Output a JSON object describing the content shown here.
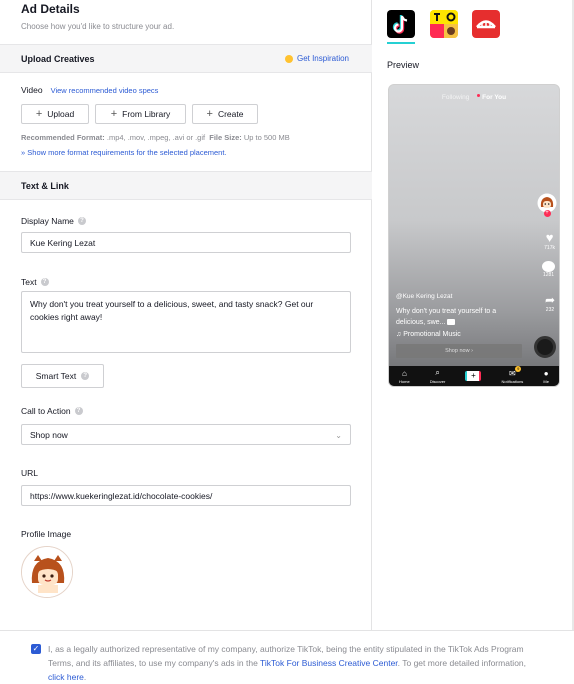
{
  "header": {
    "title": "Ad Details",
    "subtitle": "Choose how you'd like to structure your ad."
  },
  "upload": {
    "section_title": "Upload Creatives",
    "inspiration": "Get Inspiration",
    "video_label": "Video",
    "video_specs_link": "View recommended video specs",
    "buttons": {
      "upload": "Upload",
      "library": "From Library",
      "create": "Create"
    },
    "format_label": "Recommended Format:",
    "format_value": ".mp4, .mov, .mpeg, .avi or .gif",
    "size_label": "File Size:",
    "size_value": "Up to 500 MB",
    "more_link": "Show more format requirements for the selected placement."
  },
  "text_link": {
    "section_title": "Text & Link",
    "display_name_label": "Display Name",
    "display_name_value": "Kue Kering Lezat",
    "text_label": "Text",
    "text_value": "Why don't you treat yourself to a delicious, sweet, and tasty snack? Get our cookies right away!",
    "smart_text": "Smart Text",
    "cta_label": "Call to Action",
    "cta_value": "Shop now",
    "url_label": "URL",
    "url_value": "https://www.kuekeringlezat.id/chocolate-cookies/",
    "profile_label": "Profile Image"
  },
  "footer": {
    "consent_1": "I, as a legally authorized representative of my company, authorize TikTok, being the entity stipulated in the TikTok Ads Program Terms, and its affiliates, to use my company's ads in the ",
    "consent_link": "TikTok For Business Creative Center",
    "consent_2": ". To get more detailed information, ",
    "consent_link2": "click here",
    "consent_3": "."
  },
  "preview": {
    "label": "Preview",
    "top_following": "Following",
    "top_foryou": "For You",
    "likes": "717k",
    "comments": "1281",
    "shares": "232",
    "handle": "@Kue Kering Lezat",
    "caption": "Why don't you treat yourself to a delicious, swe...",
    "music": "Promotional Music",
    "shop": "Shop now ›",
    "nav": [
      "Home",
      "Discover",
      "Notifications",
      "Me"
    ],
    "notif_count": "9"
  },
  "colors": {
    "accent": "#2c5bd4",
    "tiktok_red": "#fe2c55",
    "tiktok_cyan": "#25d0d3",
    "inspiration_bulb": "#ffc230"
  }
}
